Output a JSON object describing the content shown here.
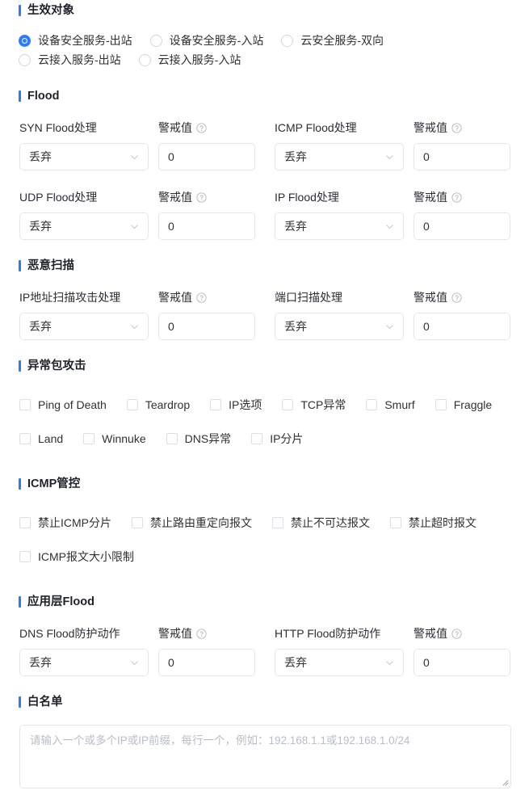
{
  "theme": {
    "accent": "#2f7bf6",
    "border": "#e3e6eb",
    "text": "#303133",
    "placeholder": "#b9bdc6"
  },
  "sections": {
    "target": {
      "title": "生效对象",
      "radios": [
        {
          "label": "设备安全服务-出站",
          "checked": true
        },
        {
          "label": "设备安全服务-入站",
          "checked": false
        },
        {
          "label": "云安全服务-双向",
          "checked": false
        },
        {
          "label": "云接入服务-出站",
          "checked": false
        },
        {
          "label": "云接入服务-入站",
          "checked": false
        }
      ]
    },
    "flood": {
      "title": "Flood",
      "fields": [
        {
          "label": "SYN Flood处理",
          "value": "丢弃",
          "threshold_label": "警戒值",
          "threshold_value": "0",
          "help": true
        },
        {
          "label": "ICMP Flood处理",
          "value": "丢弃",
          "threshold_label": "警戒值",
          "threshold_value": "0",
          "help": true
        },
        {
          "label": "UDP Flood处理",
          "value": "丢弃",
          "threshold_label": "警戒值",
          "threshold_value": "0",
          "help": true
        },
        {
          "label": "IP Flood处理",
          "value": "丢弃",
          "threshold_label": "警戒值",
          "threshold_value": "0",
          "help": true
        }
      ]
    },
    "malicious_scan": {
      "title": "恶意扫描",
      "fields": [
        {
          "label": "IP地址扫描攻击处理",
          "value": "丢弃",
          "threshold_label": "警戒值",
          "threshold_value": "0",
          "help": true
        },
        {
          "label": "端口扫描处理",
          "value": "丢弃",
          "threshold_label": "警戒值",
          "threshold_value": "0",
          "help": true
        }
      ]
    },
    "abnormal_packet": {
      "title": "异常包攻击",
      "checkboxes_row1": [
        {
          "label": "Ping of Death",
          "checked": false
        },
        {
          "label": "Teardrop",
          "checked": false
        },
        {
          "label": "IP选项",
          "checked": false
        },
        {
          "label": "TCP异常",
          "checked": false
        },
        {
          "label": "Smurf",
          "checked": false
        },
        {
          "label": "Fraggle",
          "checked": false
        }
      ],
      "checkboxes_row2": [
        {
          "label": "Land",
          "checked": false
        },
        {
          "label": "Winnuke",
          "checked": false
        },
        {
          "label": "DNS异常",
          "checked": false
        },
        {
          "label": "IP分片",
          "checked": false
        }
      ]
    },
    "icmp_control": {
      "title": "ICMP管控",
      "checkboxes_row1": [
        {
          "label": "禁止ICMP分片",
          "checked": false
        },
        {
          "label": "禁止路由重定向报文",
          "checked": false
        },
        {
          "label": "禁止不可达报文",
          "checked": false
        },
        {
          "label": "禁止超时报文",
          "checked": false
        }
      ],
      "checkboxes_row2": [
        {
          "label": "ICMP报文大小限制",
          "checked": false
        }
      ]
    },
    "app_flood": {
      "title": "应用层Flood",
      "fields": [
        {
          "label": "DNS Flood防护动作",
          "value": "丢弃",
          "threshold_label": "警戒值",
          "threshold_value": "0",
          "help": true
        },
        {
          "label": "HTTP Flood防护动作",
          "value": "丢弃",
          "threshold_label": "警戒值",
          "threshold_value": "0",
          "help": true
        }
      ]
    },
    "whitelist": {
      "title": "白名单",
      "placeholder": "请输入一个或多个IP或IP前缀，每行一个，例如：192.168.1.1或192.168.1.0/24",
      "value": ""
    }
  },
  "icons": {
    "help": "question-circle-icon",
    "chevron": "chevron-down-icon",
    "resize": "resize-grip-icon"
  }
}
